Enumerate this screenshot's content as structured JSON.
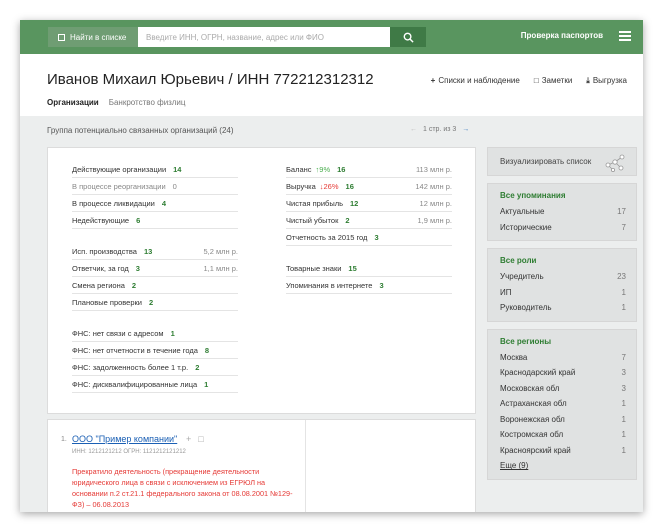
{
  "topbar": {
    "search_toggle_label": "Найти в списке",
    "search_placeholder": "Введите ИНН, ОГРН, название, адрес или ФИО",
    "passports_label": "Проверка паспортов"
  },
  "header": {
    "title": "Иванов Михаил Юрьевич / ИНН 772212312312",
    "tabs": [
      {
        "label": "Организации"
      },
      {
        "label": "Банкротство физлиц"
      }
    ],
    "actions": [
      {
        "icon": "plus-icon",
        "label": "Списки и наблюдение"
      },
      {
        "icon": "comment-icon",
        "label": "Заметки"
      },
      {
        "icon": "download-icon",
        "label": "Выгрузка"
      }
    ]
  },
  "group": {
    "title": "Группа потенциально связанных организаций (24)",
    "pager_text": "1 стр. из 3"
  },
  "stats_left": [
    {
      "label": "Действующие организации",
      "count": "14"
    },
    {
      "label": "В процессе реорганизации",
      "count": "0"
    },
    {
      "label": "В процессе ликвидации",
      "count": "4"
    },
    {
      "label": "Недействующие",
      "count": "6"
    },
    {
      "label": "Исп. производства",
      "count": "13",
      "amount": "5,2 млн р."
    },
    {
      "label": "Ответчик, за год",
      "count": "3",
      "amount": "1,1 млн р."
    },
    {
      "label": "Смена региона",
      "count": "2"
    },
    {
      "label": "Плановые проверки",
      "count": "2"
    },
    {
      "label": "ФНС: нет связи с адресом",
      "count": "1"
    },
    {
      "label": "ФНС: нет отчетности в течение года",
      "count": "8"
    },
    {
      "label": "ФНС: задолженность более 1 т.р.",
      "count": "2"
    },
    {
      "label": "ФНС: дисквалифицированные лица",
      "count": "1"
    }
  ],
  "stats_right": [
    {
      "label": "Баланс",
      "change": "9%",
      "count": "16",
      "amount": "113 млн р."
    },
    {
      "label": "Выручка",
      "change": "26%",
      "count": "16",
      "amount": "142 млн р."
    },
    {
      "label": "Чистая прибыль",
      "count": "12",
      "amount": "12 млн р."
    },
    {
      "label": "Чистый убыток",
      "count": "2",
      "amount": "1,9 млн р."
    },
    {
      "label": "Отчетность за 2015 год",
      "count": "3"
    },
    {
      "label": "Товарные знаки",
      "count": "15"
    },
    {
      "label": "Упоминания в интернете",
      "count": "3"
    }
  ],
  "sidebar": {
    "visualize_label": "Визуализировать список",
    "mentions": {
      "header": "Все упоминания",
      "items": [
        {
          "label": "Актуальные",
          "count": "17"
        },
        {
          "label": "Исторические",
          "count": "7"
        }
      ]
    },
    "roles": {
      "header": "Все роли",
      "items": [
        {
          "label": "Учредитель",
          "count": "23"
        },
        {
          "label": "ИП",
          "count": "1"
        },
        {
          "label": "Руководитель",
          "count": "1"
        }
      ]
    },
    "regions": {
      "header": "Все регионы",
      "items": [
        {
          "label": "Москва",
          "count": "7"
        },
        {
          "label": "Краснодарский край",
          "count": "3"
        },
        {
          "label": "Московская обл",
          "count": "3"
        },
        {
          "label": "Астраханская обл",
          "count": "1"
        },
        {
          "label": "Воронежская обл",
          "count": "1"
        },
        {
          "label": "Костромская обл",
          "count": "1"
        },
        {
          "label": "Красноярский край",
          "count": "1"
        }
      ],
      "more_label": "Еще (9)"
    }
  },
  "list": {
    "item": {
      "number": "1.",
      "name": "ООО \"Пример компании\"",
      "ids": "ИНН: 1212121212    ОГРН: 1121212121212",
      "status": "Прекратило деятельность (прекращение деятельности юридического лица в связи с исключением из ЕГРЮЛ на основании п.2 ст.21.1 федерального закона от 08.08.2001 №129-ФЗ) – 06.08.2013"
    }
  },
  "colors": {
    "brand_green": "#59955f",
    "count_green": "#2e7d32",
    "alert_red": "#e53935",
    "link_blue": "#1a5fb4"
  }
}
